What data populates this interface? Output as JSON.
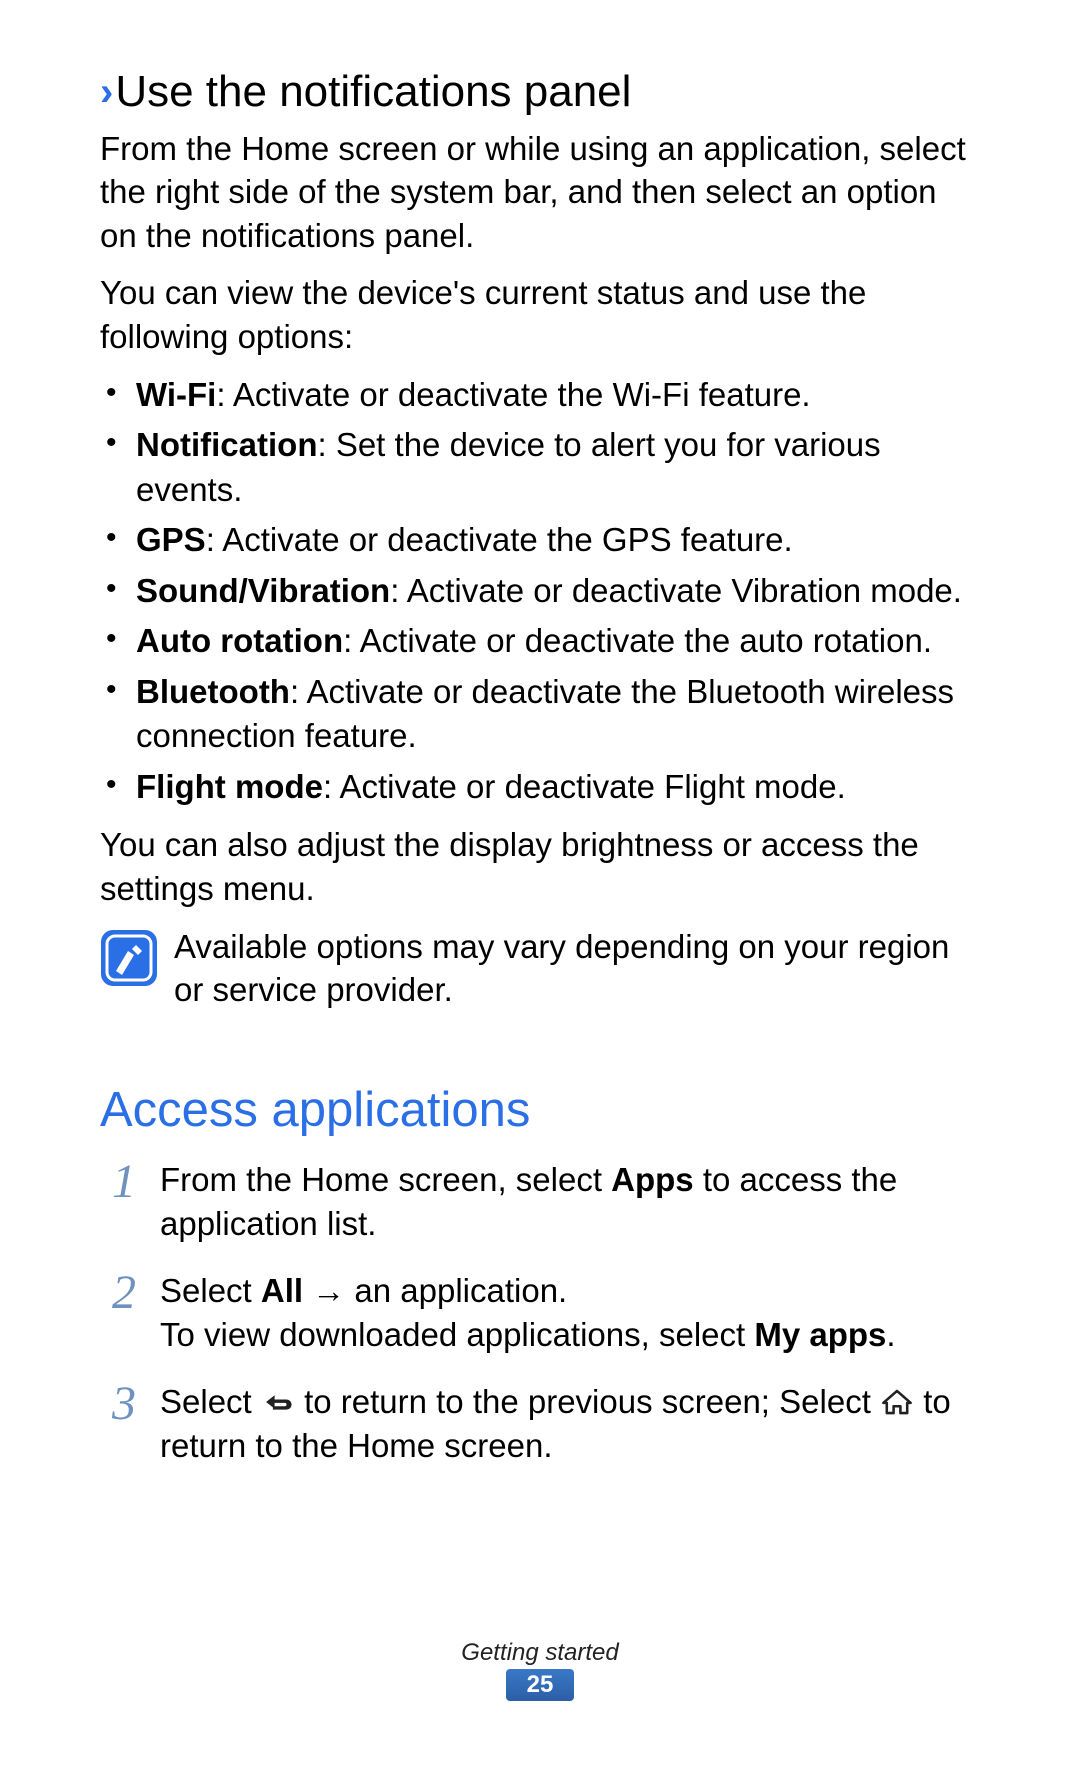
{
  "heading": {
    "chevron": "›",
    "title": "Use the notifications panel"
  },
  "intro1": "From the Home screen or while using an application, select the right side of the system bar, and then select an option on the notifications panel.",
  "intro2": "You can view the device's current status and use the following options:",
  "options": [
    {
      "term": "Wi-Fi",
      "desc": ": Activate or deactivate the Wi-Fi feature."
    },
    {
      "term": "Notification",
      "desc": ": Set the device to alert you for various events."
    },
    {
      "term": "GPS",
      "desc": ": Activate or deactivate the GPS feature."
    },
    {
      "term": "Sound/Vibration",
      "desc": ": Activate or deactivate Vibration mode."
    },
    {
      "term": "Auto rotation",
      "desc": ": Activate or deactivate the auto rotation."
    },
    {
      "term": "Bluetooth",
      "desc": ": Activate or deactivate the Bluetooth wireless connection feature."
    },
    {
      "term": "Flight mode",
      "desc": ": Activate or deactivate Flight mode."
    }
  ],
  "after_options": "You can also adjust the display brightness or access the settings menu.",
  "note": "Available options may vary depending on your region or service provider.",
  "section_title": "Access applications",
  "steps": {
    "s1": {
      "num": "1",
      "pre": "From the Home screen, select ",
      "b1": "Apps",
      "post": " to access the application list."
    },
    "s2": {
      "num": "2",
      "l1_pre": "Select ",
      "l1_b": "All",
      "l1_arrow": " → ",
      "l1_post": "an application.",
      "l2_pre": "To view downloaded applications, select ",
      "l2_b": "My apps",
      "l2_post": "."
    },
    "s3": {
      "num": "3",
      "pre": "Select ",
      "mid": " to return to the previous screen; Select ",
      "post": " to return to the Home screen."
    }
  },
  "footer": {
    "section": "Getting started",
    "page": "25"
  }
}
